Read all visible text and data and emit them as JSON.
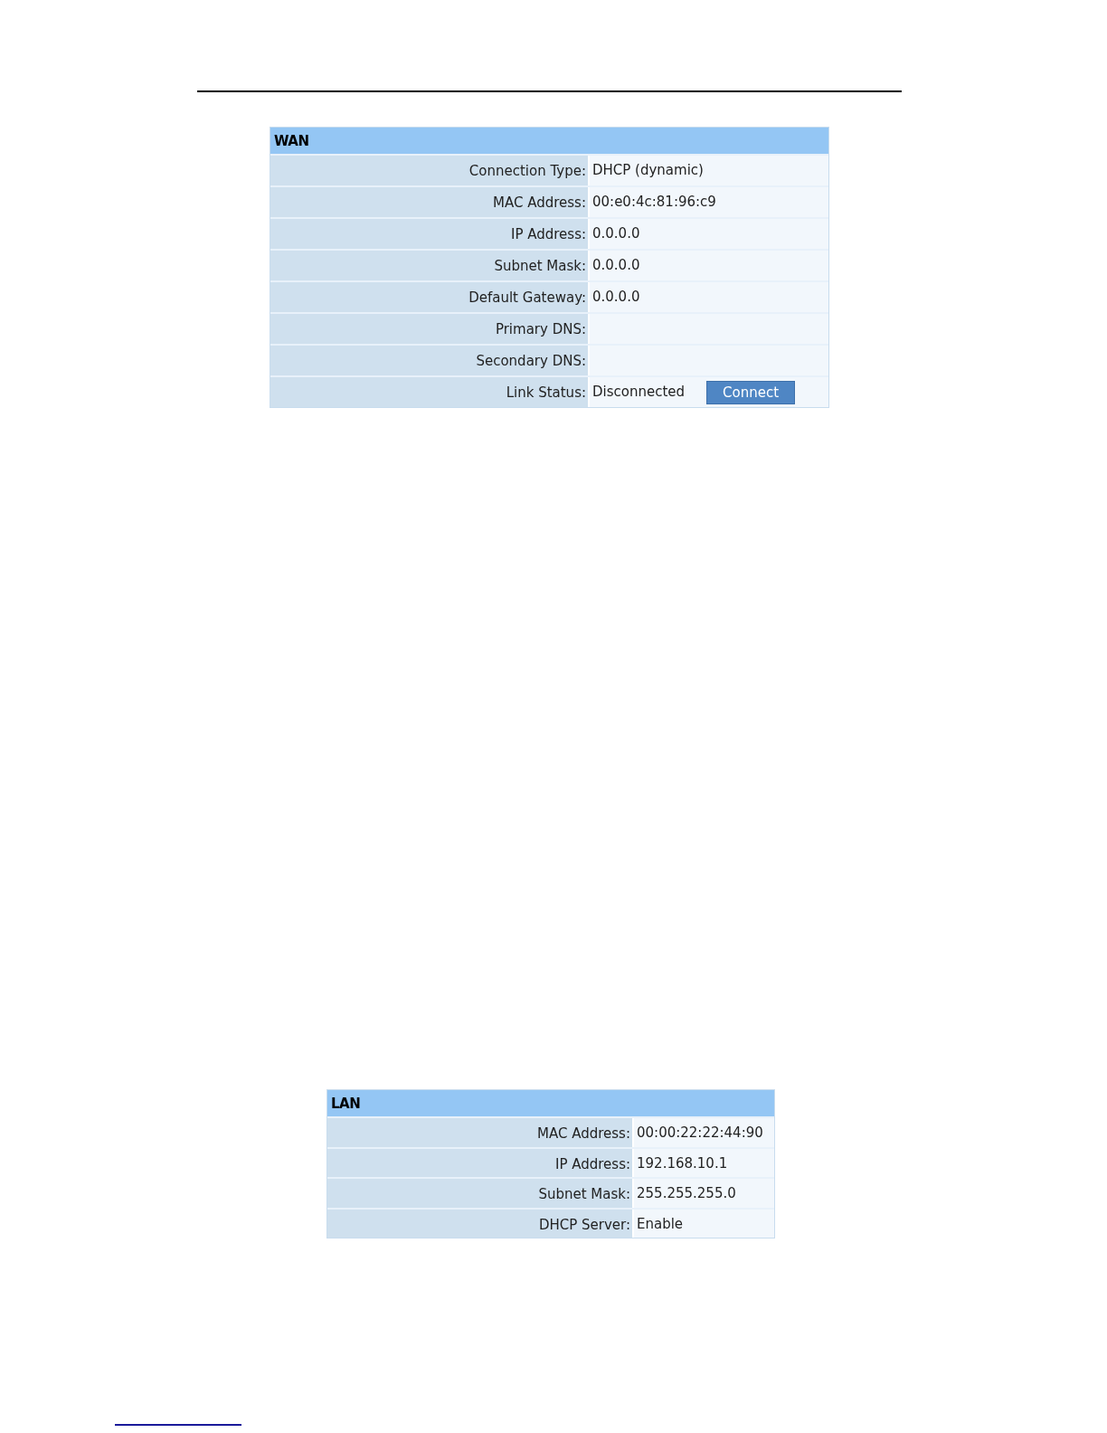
{
  "sections": [
    {
      "title": "WAN",
      "rows": [
        {
          "label": "Connection Type:",
          "value": "DHCP (dynamic)"
        },
        {
          "label": "MAC Address:",
          "value": "00:e0:4c:81:96:c9"
        },
        {
          "label": "IP Address:",
          "value": "0.0.0.0"
        },
        {
          "label": "Subnet Mask:",
          "value": "0.0.0.0"
        },
        {
          "label": "Default Gateway:",
          "value": "0.0.0.0"
        },
        {
          "label": "Primary DNS:"
        },
        {
          "label": "Secondary DNS:"
        },
        {
          "label": "Link Status:",
          "value": "Disconnected",
          "button": "Connect"
        }
      ]
    },
    {
      "title": "LAN",
      "rows": [
        {
          "label": "MAC Address:",
          "value": "00:00:22:22:44:90"
        },
        {
          "label": "IP Address:",
          "value": "192.168.10.1"
        },
        {
          "label": "Subnet Mask:",
          "value": "255.255.255.0"
        },
        {
          "label": "DHCP Server:",
          "value": "Enable"
        }
      ]
    }
  ]
}
